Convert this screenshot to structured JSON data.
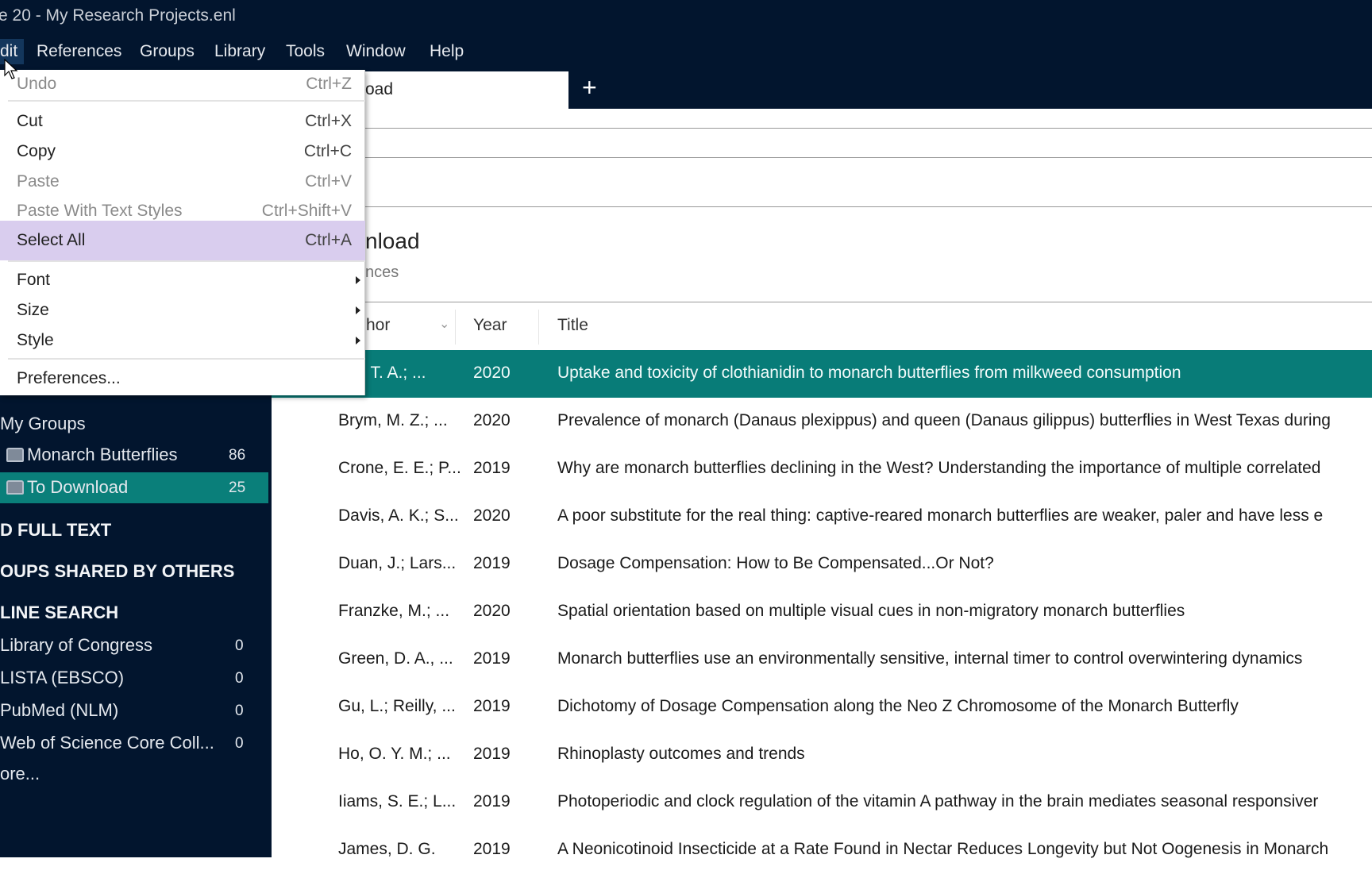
{
  "window": {
    "title": "e 20 - My Research Projects.enl"
  },
  "menubar": [
    "dit",
    "References",
    "Groups",
    "Library",
    "Tools",
    "Window",
    "Help"
  ],
  "tab": {
    "label": "oad",
    "add_icon": "plus-icon"
  },
  "group_header": {
    "title": "nload",
    "subtitle": "nces"
  },
  "columns": {
    "author": "hor",
    "year": "Year",
    "title": "Title"
  },
  "rows": [
    {
      "author": "gar, T. A.; ...",
      "year": "2020",
      "title": "Uptake and toxicity of clothianidin to monarch butterflies from milkweed consumption",
      "selected": true
    },
    {
      "author": "Brym, M. Z.; ...",
      "year": "2020",
      "title": "Prevalence of monarch (Danaus plexippus) and queen (Danaus gilippus) butterflies in West Texas during"
    },
    {
      "author": "Crone, E. E.; P...",
      "year": "2019",
      "title": "Why are monarch butterflies declining in the West? Understanding the importance of multiple correlated"
    },
    {
      "author": "Davis, A. K.; S...",
      "year": "2020",
      "title": "A poor substitute for the real thing: captive-reared monarch butterflies are weaker, paler and have less e"
    },
    {
      "author": "Duan, J.; Lars...",
      "year": "2019",
      "title": "Dosage Compensation: How to Be Compensated...Or Not?"
    },
    {
      "author": "Franzke, M.; ...",
      "year": "2020",
      "title": "Spatial orientation based on multiple visual cues in non-migratory monarch butterflies"
    },
    {
      "author": "Green, D. A., ...",
      "year": "2019",
      "title": "Monarch butterflies use an environmentally sensitive, internal timer to control overwintering dynamics"
    },
    {
      "author": "Gu, L.; Reilly, ...",
      "year": "2019",
      "title": "Dichotomy of Dosage Compensation along the Neo Z Chromosome of the Monarch Butterfly"
    },
    {
      "author": "Ho, O. Y. M.; ...",
      "year": "2019",
      "title": "Rhinoplasty outcomes and trends"
    },
    {
      "author": "Iiams, S. E.; L...",
      "year": "2019",
      "title": "Photoperiodic and clock regulation of the vitamin A pathway in the brain mediates seasonal responsiver"
    },
    {
      "author": "James, D. G.",
      "year": "2019",
      "title": "A Neonicotinoid Insecticide at a Rate Found in Nectar Reduces Longevity but Not Oogenesis in Monarch"
    }
  ],
  "sidebar": {
    "my_groups": "My Groups",
    "groups": [
      {
        "label": "Monarch Butterflies",
        "count": "86"
      },
      {
        "label": "To Download",
        "count": "25",
        "selected": true
      }
    ],
    "find_full_text": "D FULL TEXT",
    "shared": "OUPS SHARED BY OTHERS",
    "online_search": "LINE SEARCH",
    "online": [
      {
        "label": "Library of Congress",
        "count": "0"
      },
      {
        "label": "LISTA (EBSCO)",
        "count": "0"
      },
      {
        "label": "PubMed (NLM)",
        "count": "0"
      },
      {
        "label": "Web of Science Core Coll...",
        "count": "0"
      }
    ],
    "more": "ore..."
  },
  "edit_menu": [
    {
      "label": "Undo",
      "shortcut": "Ctrl+Z",
      "disabled": true
    },
    {
      "label": "Cut",
      "shortcut": "Ctrl+X"
    },
    {
      "label": "Copy",
      "shortcut": "Ctrl+C"
    },
    {
      "label": "Paste",
      "shortcut": "Ctrl+V",
      "disabled": true
    },
    {
      "label": "Paste With Text Styles",
      "shortcut": "Ctrl+Shift+V",
      "disabled": true
    },
    {
      "label": "Select All",
      "shortcut": "Ctrl+A",
      "highlighted": true
    },
    {
      "label": "Font",
      "submenu": true
    },
    {
      "label": "Size",
      "submenu": true
    },
    {
      "label": "Style",
      "submenu": true
    },
    {
      "label": "Preferences..."
    }
  ],
  "colors": {
    "navy": "#02152e",
    "teal": "#087c78",
    "menu_highlight": "#d9cdee"
  }
}
